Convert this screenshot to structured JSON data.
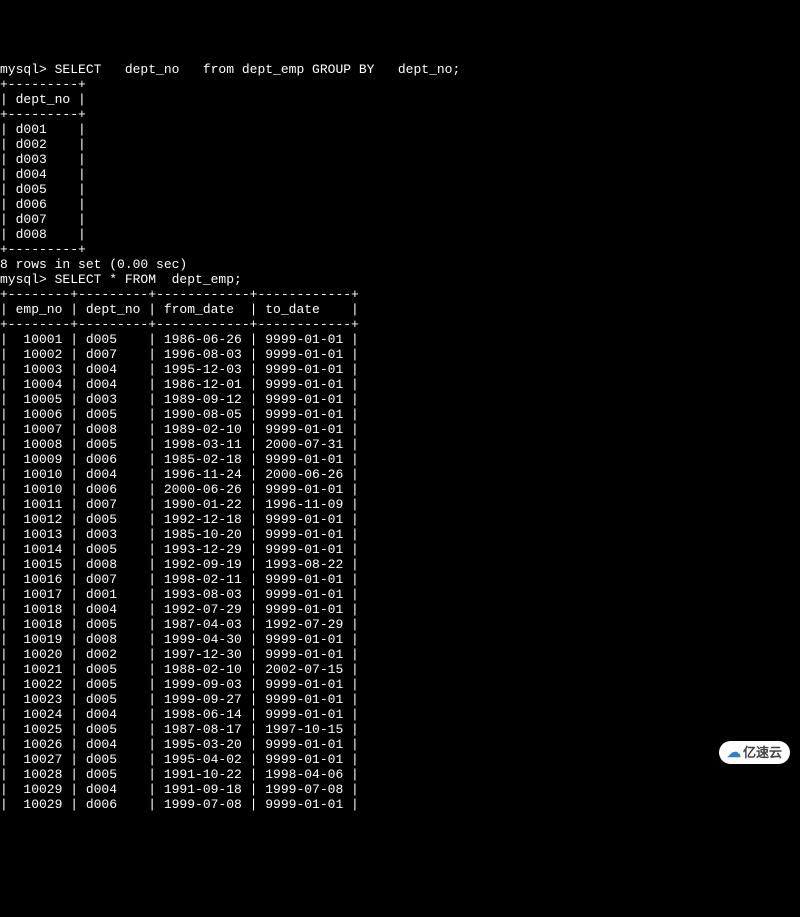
{
  "query1": {
    "prompt": "mysql> ",
    "sql": "SELECT   dept_no   from dept_emp GROUP BY   dept_no;",
    "sep": "+---------+",
    "header": "| dept_no |",
    "rows": [
      "| d001    |",
      "| d002    |",
      "| d003    |",
      "| d004    |",
      "| d005    |",
      "| d006    |",
      "| d007    |",
      "| d008    |"
    ],
    "footer": "8 rows in set (0.00 sec)"
  },
  "query2": {
    "prompt": "mysql> ",
    "sql": "SELECT * FROM  dept_emp;",
    "sep": "+--------+---------+------------+------------+",
    "header": "| emp_no | dept_no | from_date  | to_date    |",
    "rows": [
      "|  10001 | d005    | 1986-06-26 | 9999-01-01 |",
      "|  10002 | d007    | 1996-08-03 | 9999-01-01 |",
      "|  10003 | d004    | 1995-12-03 | 9999-01-01 |",
      "|  10004 | d004    | 1986-12-01 | 9999-01-01 |",
      "|  10005 | d003    | 1989-09-12 | 9999-01-01 |",
      "|  10006 | d005    | 1990-08-05 | 9999-01-01 |",
      "|  10007 | d008    | 1989-02-10 | 9999-01-01 |",
      "|  10008 | d005    | 1998-03-11 | 2000-07-31 |",
      "|  10009 | d006    | 1985-02-18 | 9999-01-01 |",
      "|  10010 | d004    | 1996-11-24 | 2000-06-26 |",
      "|  10010 | d006    | 2000-06-26 | 9999-01-01 |",
      "|  10011 | d007    | 1990-01-22 | 1996-11-09 |",
      "|  10012 | d005    | 1992-12-18 | 9999-01-01 |",
      "|  10013 | d003    | 1985-10-20 | 9999-01-01 |",
      "|  10014 | d005    | 1993-12-29 | 9999-01-01 |",
      "|  10015 | d008    | 1992-09-19 | 1993-08-22 |",
      "|  10016 | d007    | 1998-02-11 | 9999-01-01 |",
      "|  10017 | d001    | 1993-08-03 | 9999-01-01 |",
      "|  10018 | d004    | 1992-07-29 | 9999-01-01 |",
      "|  10018 | d005    | 1987-04-03 | 1992-07-29 |",
      "|  10019 | d008    | 1999-04-30 | 9999-01-01 |",
      "|  10020 | d002    | 1997-12-30 | 9999-01-01 |",
      "|  10021 | d005    | 1988-02-10 | 2002-07-15 |",
      "|  10022 | d005    | 1999-09-03 | 9999-01-01 |",
      "|  10023 | d005    | 1999-09-27 | 9999-01-01 |",
      "|  10024 | d004    | 1998-06-14 | 9999-01-01 |",
      "|  10025 | d005    | 1987-08-17 | 1997-10-15 |",
      "|  10026 | d004    | 1995-03-20 | 9999-01-01 |",
      "|  10027 | d005    | 1995-04-02 | 9999-01-01 |",
      "|  10028 | d005    | 1991-10-22 | 1998-04-06 |",
      "|  10029 | d004    | 1991-09-18 | 1999-07-08 |",
      "|  10029 | d006    | 1999-07-08 | 9999-01-01 |"
    ]
  },
  "watermark": "亿速云"
}
